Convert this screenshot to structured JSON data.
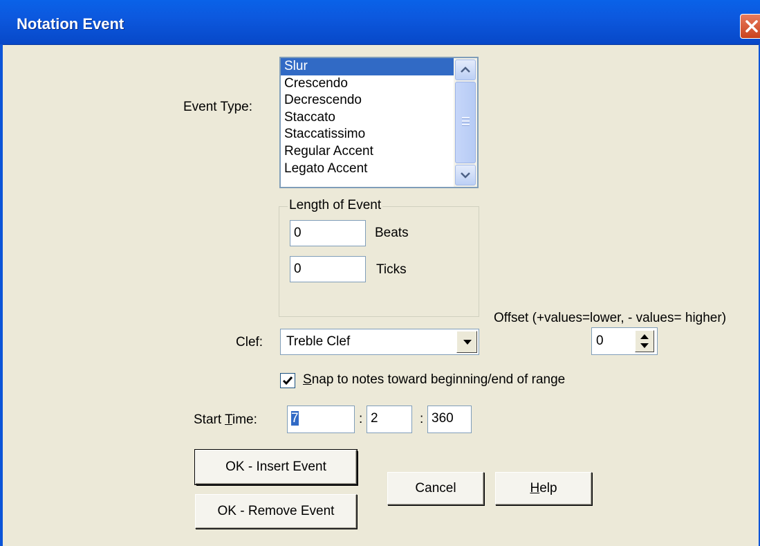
{
  "window": {
    "title": "Notation Event"
  },
  "event_type": {
    "label": "Event Type:",
    "items": [
      "Slur",
      "Crescendo",
      "Decrescendo",
      "Staccato",
      "Staccatissimo",
      "Regular Accent",
      "Legato Accent"
    ],
    "selected": "Slur"
  },
  "length_of_event": {
    "title": "Length of Event",
    "beats_value": "0",
    "beats_label": "Beats",
    "ticks_value": "0",
    "ticks_label": "Ticks"
  },
  "offset": {
    "label": "Offset (+values=lower, - values= higher)",
    "value": "0"
  },
  "clef": {
    "label": "Clef:",
    "value": "Treble Clef"
  },
  "snap": {
    "checked": true,
    "label_first": "S",
    "label_rest": "nap to notes toward beginning/end of range"
  },
  "start_time": {
    "label_pre": "Start ",
    "label_ul": "T",
    "label_post": "ime:",
    "bar": "7",
    "beat": "2",
    "tick": "360",
    "sep": ":"
  },
  "buttons": {
    "ok_insert": "OK - Insert Event",
    "ok_remove": "OK - Remove Event",
    "cancel": "Cancel",
    "help_ul": "H",
    "help_rest": "elp"
  },
  "icons": {
    "close": "close-icon",
    "scroll_up": "scroll-up-arrow-icon",
    "scroll_down": "scroll-down-arrow-icon",
    "dropdown": "dropdown-arrow-icon",
    "spin": "spin-up-down-icon",
    "check": "checkmark-icon"
  }
}
